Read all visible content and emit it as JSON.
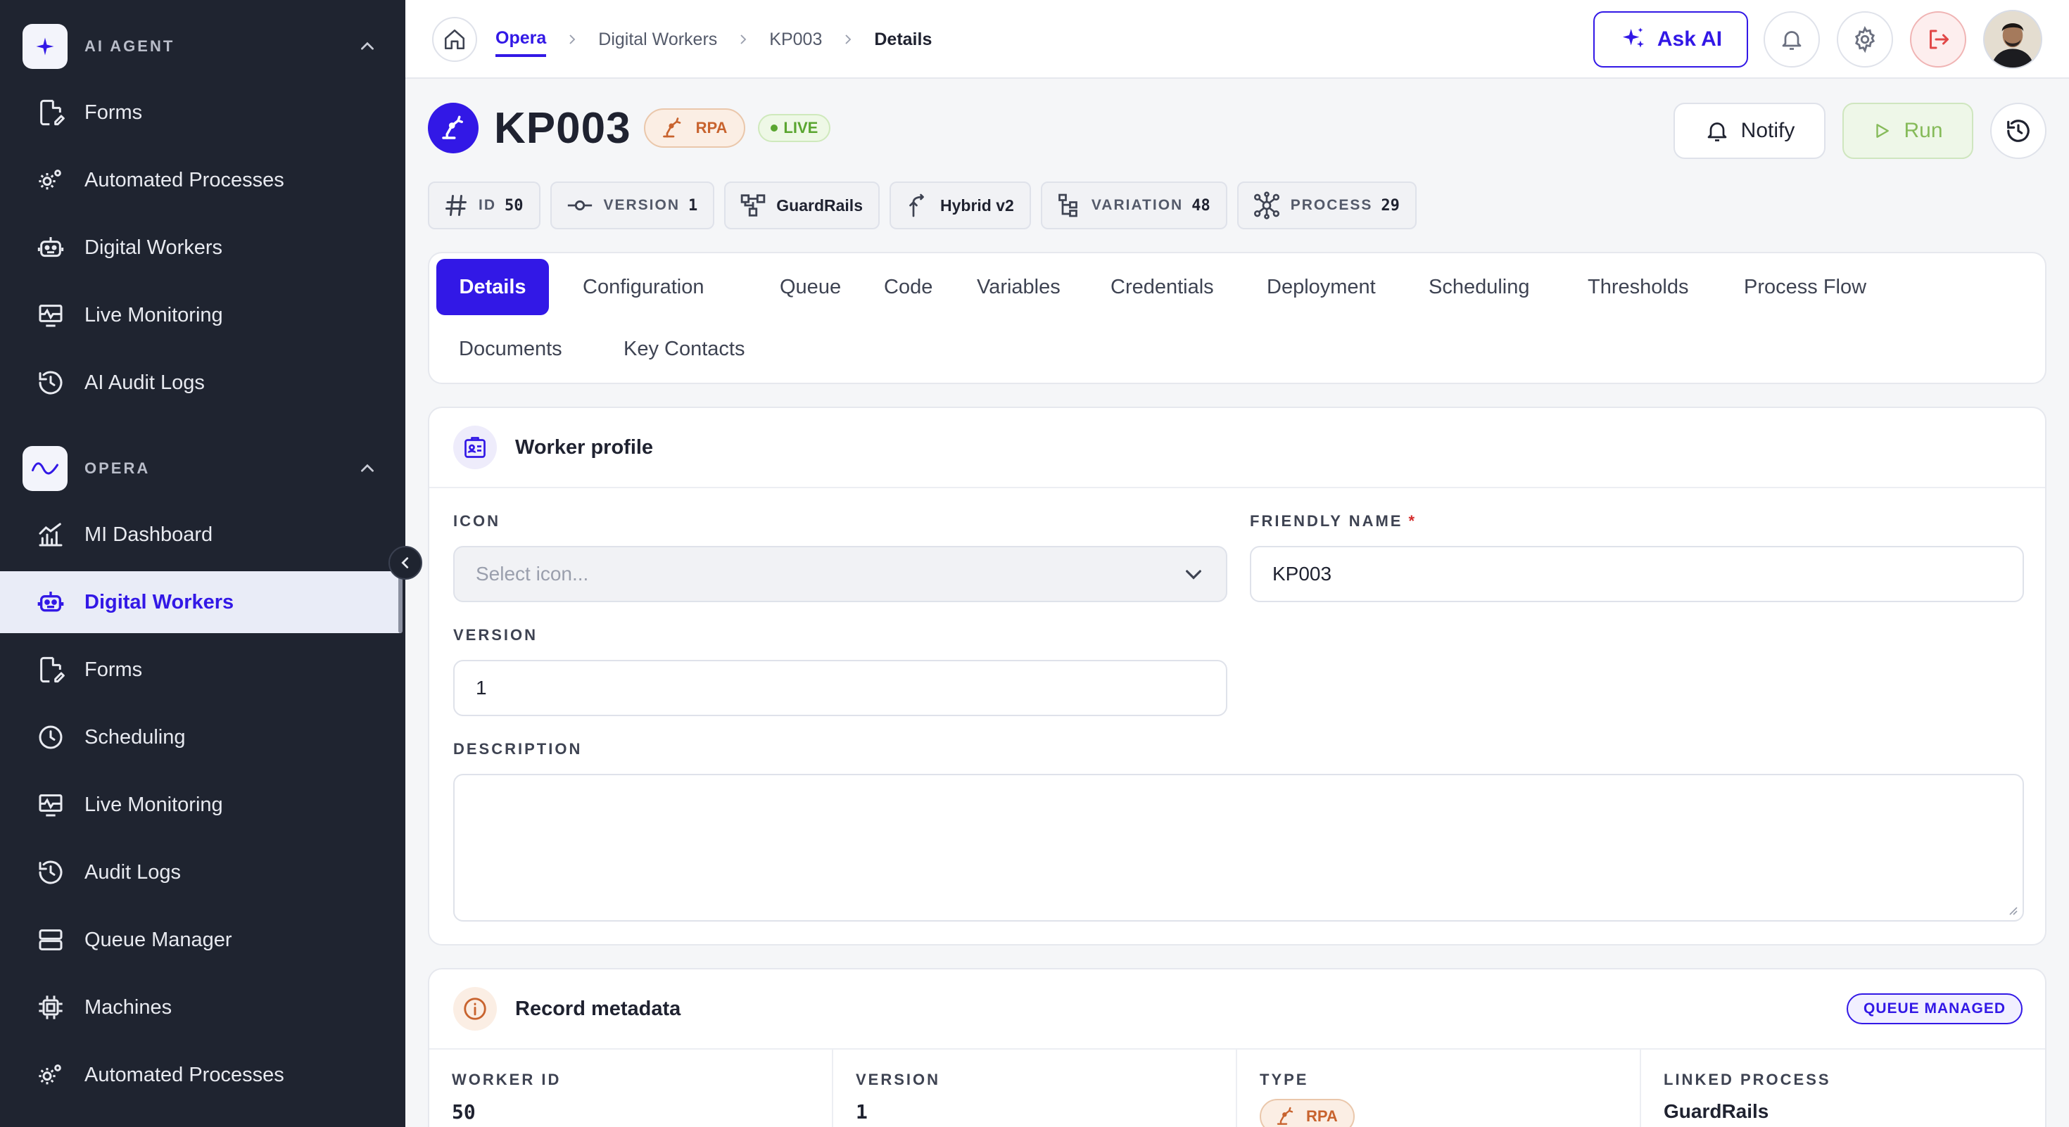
{
  "sidebar": {
    "sections": [
      {
        "label": "AI AGENT",
        "items": [
          {
            "label": "Forms",
            "icon": "form-icon"
          },
          {
            "label": "Automated Processes",
            "icon": "gears-icon"
          },
          {
            "label": "Digital Workers",
            "icon": "robot-icon"
          },
          {
            "label": "Live Monitoring",
            "icon": "monitor-icon"
          },
          {
            "label": "AI Audit Logs",
            "icon": "history-icon"
          }
        ]
      },
      {
        "label": "OPERA",
        "items": [
          {
            "label": "MI Dashboard",
            "icon": "chart-icon"
          },
          {
            "label": "Digital Workers",
            "icon": "robot-icon",
            "active": true
          },
          {
            "label": "Forms",
            "icon": "form-icon"
          },
          {
            "label": "Scheduling",
            "icon": "clock-icon"
          },
          {
            "label": "Live Monitoring",
            "icon": "monitor-icon"
          },
          {
            "label": "Audit Logs",
            "icon": "history-icon"
          },
          {
            "label": "Queue Manager",
            "icon": "queue-icon"
          },
          {
            "label": "Machines",
            "icon": "chip-icon"
          },
          {
            "label": "Automated Processes",
            "icon": "gears-icon"
          }
        ]
      }
    ]
  },
  "breadcrumb": [
    "Opera",
    "Digital Workers",
    "KP003",
    "Details"
  ],
  "topbar": {
    "ask_ai": "Ask AI"
  },
  "header": {
    "title": "KP003",
    "type_badge": "RPA",
    "status_badge": "LIVE",
    "notify": "Notify",
    "run": "Run"
  },
  "chips": [
    {
      "key": "ID",
      "value": "50"
    },
    {
      "key": "VERSION",
      "value": "1"
    },
    {
      "text": "GuardRails"
    },
    {
      "text": "Hybrid v2"
    },
    {
      "key": "VARIATION",
      "value": "48"
    },
    {
      "key": "PROCESS",
      "value": "29"
    }
  ],
  "tabs": [
    "Details",
    "Configuration",
    "Queue",
    "Code",
    "Variables",
    "Credentials",
    "Deployment",
    "Scheduling",
    "Thresholds",
    "Process Flow",
    "Documents",
    "Key Contacts"
  ],
  "profile": {
    "title": "Worker profile",
    "icon_label": "ICON",
    "icon_placeholder": "Select icon...",
    "friendly_label": "FRIENDLY NAME",
    "friendly_value": "KP003",
    "required_mark": "*",
    "version_label": "VERSION",
    "version_value": "1",
    "description_label": "DESCRIPTION",
    "description_value": ""
  },
  "metadata": {
    "title": "Record metadata",
    "badge": "QUEUE MANAGED",
    "columns": [
      {
        "label": "WORKER ID",
        "value": "50"
      },
      {
        "label": "VERSION",
        "value": "1"
      },
      {
        "label": "TYPE",
        "value": "RPA"
      },
      {
        "label": "LINKED PROCESS",
        "value": "GuardRails"
      }
    ]
  },
  "colors": {
    "accent": "#3218e6",
    "sidebar_bg": "#1f2430",
    "live": "#5aa630",
    "rpa": "#c8632e"
  }
}
